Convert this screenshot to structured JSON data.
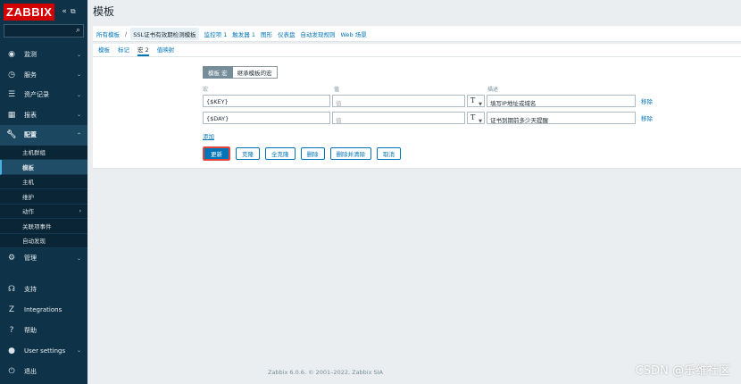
{
  "sidebar": {
    "logo": "ZABBIX",
    "collapse_glyph": "«",
    "kiosk_glyph": "⧉",
    "search_placeholder": "",
    "menu": [
      {
        "label": "监测",
        "icon": "eye-icon"
      },
      {
        "label": "服务",
        "icon": "clock-icon"
      },
      {
        "label": "资产记录",
        "icon": "list-icon"
      },
      {
        "label": "报表",
        "icon": "chart-icon"
      },
      {
        "label": "配置",
        "icon": "wrench-icon"
      }
    ],
    "submenu": [
      "主机群组",
      "模板",
      "主机",
      "维护",
      "动作",
      "关联项事件",
      "自动发现"
    ],
    "admin": {
      "label": "管理",
      "icon": "gear-icon"
    },
    "bottom": [
      {
        "label": "支持",
        "icon": "headset-icon"
      },
      {
        "label": "Integrations",
        "icon": "zabbix-z-icon"
      },
      {
        "label": "帮助",
        "icon": "question-icon"
      },
      {
        "label": "User settings",
        "icon": "user-icon"
      },
      {
        "label": "退出",
        "icon": "power-icon"
      }
    ]
  },
  "header": {
    "title": "模板"
  },
  "breadcrumb": {
    "all": "所有模板",
    "sep": "/",
    "current": "SSL证书有效期检测模板",
    "items": [
      "监控项 1",
      "触发器 1",
      "图形",
      "仪表盘",
      "自动发现规则",
      "Web 场景"
    ]
  },
  "tabs": [
    "模板",
    "标记",
    "宏 2",
    "值映射"
  ],
  "macros": {
    "seg_on": "模板 宏",
    "seg_off": "继承模板的宏",
    "col_macro": "宏",
    "col_value": "值",
    "col_desc": "描述",
    "rows": [
      {
        "macro": "{$KEY}",
        "value_placeholder": "值",
        "type": "T",
        "desc": "填写IP地址或域名",
        "remove": "移除"
      },
      {
        "macro": "{$DAY}",
        "value_placeholder": "值",
        "type": "T",
        "desc": "证书到期前多少天提醒",
        "remove": "移除"
      }
    ],
    "add": "添加"
  },
  "buttons": {
    "update": "更新",
    "clone": "克隆",
    "full_clone": "全克隆",
    "delete": "删除",
    "delete_clear": "删除并清除",
    "cancel": "取消"
  },
  "footer": "Zabbix 6.0.6. © 2001–2022, Zabbix SIA",
  "watermark": "CSDN @乐维社区"
}
